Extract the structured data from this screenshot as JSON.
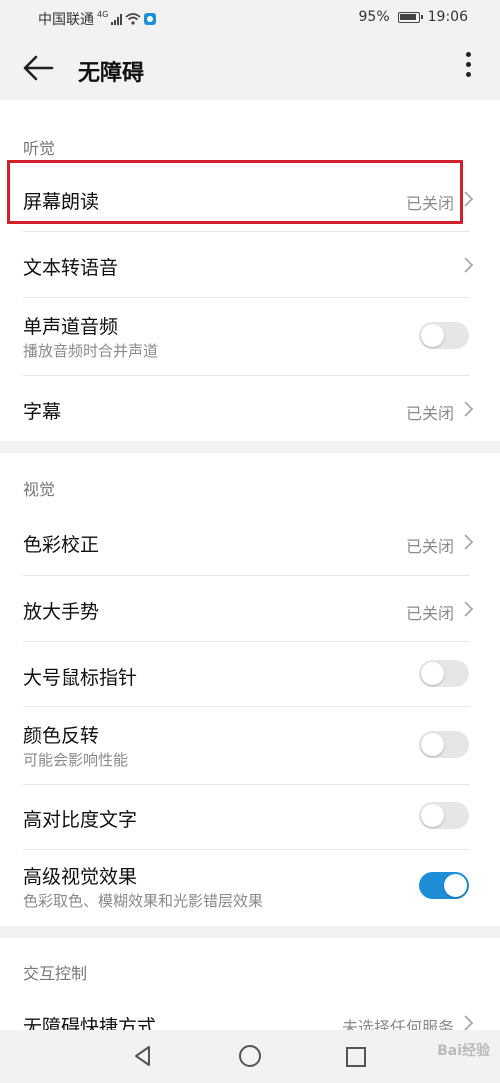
{
  "status_bar": {
    "carrier": "中国联通",
    "network": "4G",
    "battery": "95%",
    "time": "19:06"
  },
  "header": {
    "title": "无障碍"
  },
  "sections": {
    "hearing": {
      "title": "听觉",
      "screen_reader": {
        "label": "屏幕朗读",
        "value": "已关闭"
      },
      "tts": {
        "label": "文本转语音"
      },
      "mono_audio": {
        "label": "单声道音频",
        "sub": "播放音频时合并声道",
        "on": false
      },
      "captions": {
        "label": "字幕",
        "value": "已关闭"
      }
    },
    "vision": {
      "title": "视觉",
      "color_correction": {
        "label": "色彩校正",
        "value": "已关闭"
      },
      "magnification": {
        "label": "放大手势",
        "value": "已关闭"
      },
      "large_pointer": {
        "label": "大号鼠标指针",
        "on": false
      },
      "color_inversion": {
        "label": "颜色反转",
        "sub": "可能会影响性能",
        "on": false
      },
      "high_contrast": {
        "label": "高对比度文字",
        "on": false
      },
      "advanced_visual": {
        "label": "高级视觉效果",
        "sub": "色彩取色、模糊效果和光影错层效果",
        "on": true
      }
    },
    "interaction": {
      "title": "交互控制",
      "shortcut": {
        "label": "无障碍快捷方式",
        "value": "未选择任何服务"
      }
    }
  },
  "watermark": "Bai经验",
  "colors": {
    "accent": "#1e8fd6",
    "highlight": "#d0202c"
  }
}
